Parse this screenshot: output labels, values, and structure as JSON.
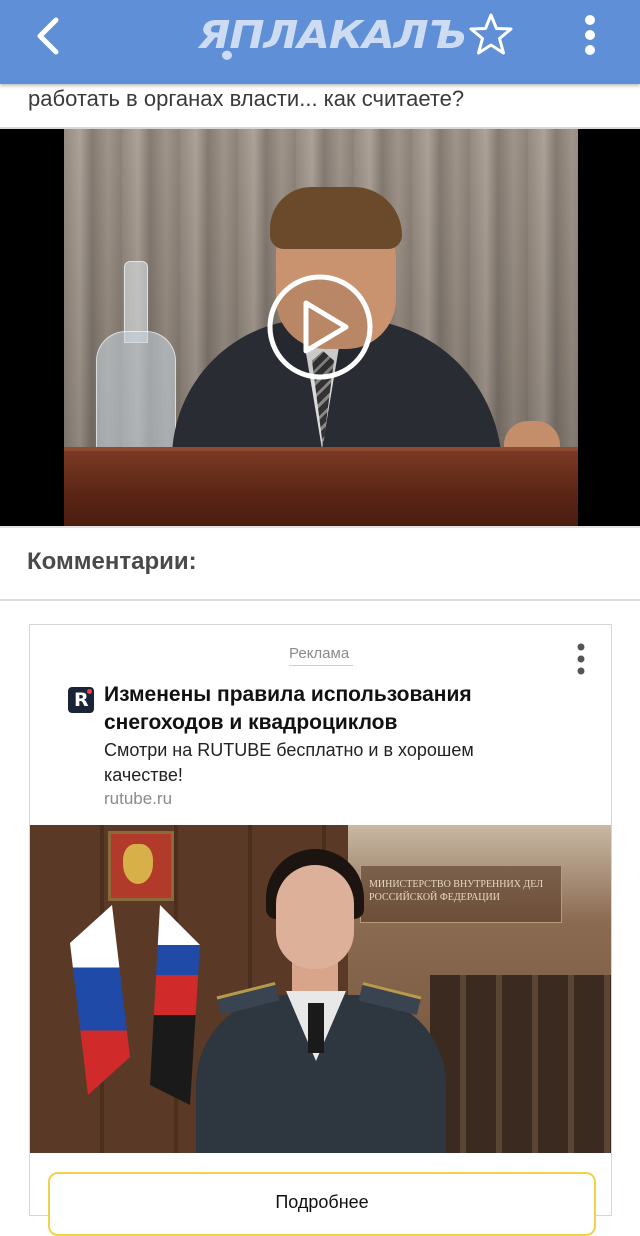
{
  "header": {
    "logo_text": "ЯПЛАКАЛЪ",
    "back_icon": "chevron-left-icon",
    "favorite_icon": "star-outline-icon",
    "menu_icon": "more-vertical-icon",
    "bg_color": "#5f8fd6"
  },
  "post": {
    "title_tail": "работать в органах власти... как считаете?"
  },
  "video": {
    "play_icon": "play-circle-icon"
  },
  "comments": {
    "heading": "Комментарии:"
  },
  "ad": {
    "label": "Реклама",
    "brand_icon": "rutube-logo",
    "brand_letter": "R",
    "title": "Изменены правила использования снегоходов и квадроциклов",
    "description": "Смотри на RUTUBE бесплатно и в хорошем качестве!",
    "domain": "rutube.ru",
    "image_sign_text": "МИНИСТЕРСТВО ВНУТРЕННИХ ДЕЛ РОССИЙСКОЙ ФЕДЕРАЦИИ",
    "cta_label": "Подробнее",
    "cta_border_color": "#f2d24a"
  }
}
